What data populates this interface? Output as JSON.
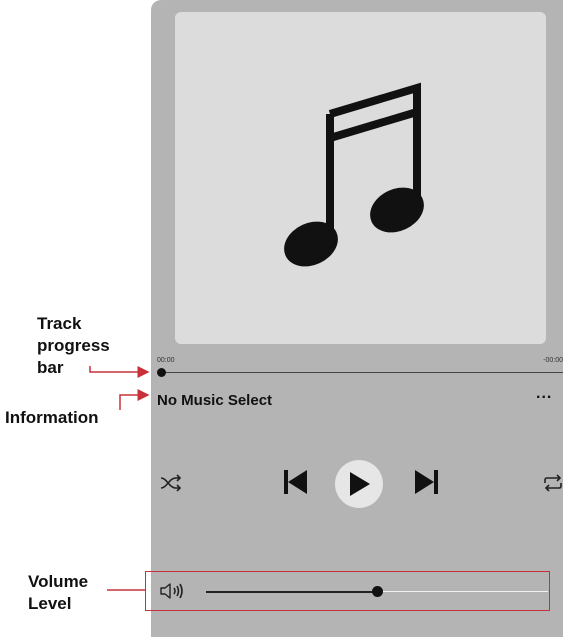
{
  "annotations": {
    "track_progress_line1": "Track",
    "track_progress_line2": "progress",
    "track_progress_line3": "bar",
    "information": "Information",
    "volume_line1": "Volume",
    "volume_line2": "Level"
  },
  "player": {
    "artwork_icon": "music-note-icon",
    "time_elapsed": "00:00",
    "time_remaining": "-00:00",
    "progress": 0,
    "track_title": "No Music Select",
    "more_label": "...",
    "controls": [
      "shuffle-icon",
      "previous-icon",
      "play-icon",
      "next-icon",
      "repeat-icon"
    ],
    "volume_icon": "speaker-icon",
    "volume_level": 0.45
  },
  "colors": {
    "player_bg": "#b4b4b4",
    "artwork_bg": "#dcdcdc",
    "annotation_red": "#c8303a"
  }
}
